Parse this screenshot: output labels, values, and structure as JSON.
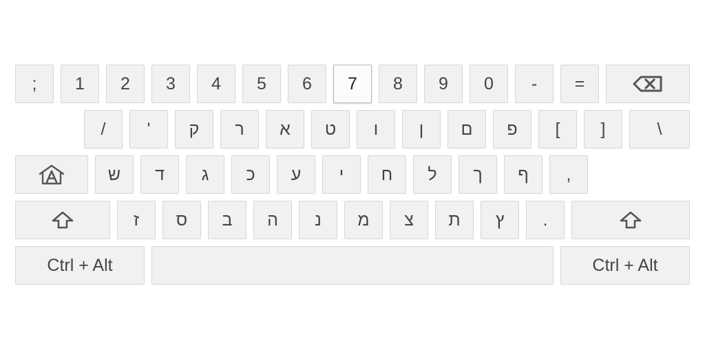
{
  "keyboard": {
    "layout": "Hebrew",
    "colors": {
      "key_bg": "#f1f1f1",
      "key_border": "#d6d6d6",
      "key_text": "#444444",
      "active_key_bg": "#fbfbfb"
    },
    "row1": [
      ";",
      "1",
      "2",
      "3",
      "4",
      "5",
      "6",
      "7",
      "8",
      "9",
      "0",
      "-",
      "="
    ],
    "row2": [
      "/",
      "'",
      "ק",
      "ר",
      "א",
      "ט",
      "ו",
      "ן",
      "ם",
      "פ",
      "[",
      "]",
      "\\"
    ],
    "row3": [
      "ש",
      "ד",
      "ג",
      "כ",
      "ע",
      "י",
      "ח",
      "ל",
      "ך",
      "ף",
      ","
    ],
    "row4": [
      "ז",
      "ס",
      "ב",
      "ה",
      "נ",
      "מ",
      "צ",
      "ת",
      "ץ",
      "."
    ],
    "active_key": "7",
    "icons": {
      "backspace": "backspace-icon",
      "home": "home-altgr-icon",
      "shift": "shift-arrow-icon"
    },
    "ctrl_alt_left": "Ctrl + Alt",
    "ctrl_alt_right": "Ctrl + Alt"
  }
}
